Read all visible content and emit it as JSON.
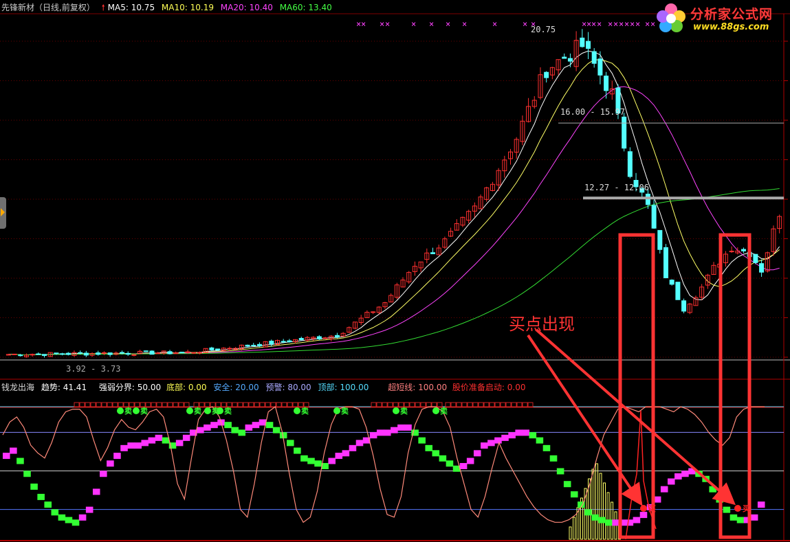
{
  "header": {
    "stock_title": "先锋新材（日线,前复权）",
    "ma_items": [
      {
        "label": "MA5:",
        "value": "10.75",
        "color": "#ffffff"
      },
      {
        "label": "MA10:",
        "value": "10.19",
        "color": "#ffff55"
      },
      {
        "label": "MA20:",
        "value": "10.40",
        "color": "#ff44ff"
      },
      {
        "label": "MA60:",
        "value": "13.40",
        "color": "#44ff44"
      }
    ],
    "logo_text": "分析家公式网",
    "logo_url": "www.88gs.com"
  },
  "main_chart": {
    "high_label": "20.75",
    "low_label": "3.92 - 3.73",
    "level1_label": "16.00 - 15.97",
    "level2_label": "12.27 - 12.06",
    "annotation": "买点出现",
    "colors": {
      "up": "#ff3030",
      "down": "#54ffff",
      "ma5": "#ffffff",
      "ma10": "#ffff66",
      "ma20": "#ff44ff",
      "ma60": "#33dd33",
      "box": "#ff3333"
    }
  },
  "indicator": {
    "name": "钱龙出海",
    "fields": [
      {
        "label": "趋势:",
        "value": "41.41",
        "color": "#ffffff"
      },
      {
        "label": "强弱分界:",
        "value": "50.00",
        "color": "#ffffff"
      },
      {
        "label": "底部:",
        "value": "0.00",
        "color": "#ffff55"
      },
      {
        "label": "安全:",
        "value": "20.00",
        "color": "#55aaff"
      },
      {
        "label": "预警:",
        "value": "80.00",
        "color": "#aaaaff"
      },
      {
        "label": "顶部:",
        "value": "100.00",
        "color": "#55ddff"
      },
      {
        "label": "超短线:",
        "value": "100.00",
        "color": "#ff8080"
      },
      {
        "label": "股价准备启动:",
        "value": "0.00",
        "color": "#ff3030"
      }
    ],
    "signal_text": "卖",
    "buy_text": "买"
  },
  "chart_data": {
    "type": "candlestick",
    "title": "先锋新材（日线,前复权）",
    "price_range": [
      3.73,
      20.75
    ],
    "ma_lines": [
      "MA5",
      "MA10",
      "MA20",
      "MA60"
    ],
    "ma_values": {
      "MA5": 10.75,
      "MA10": 10.19,
      "MA20": 10.4,
      "MA60": 13.4
    },
    "price_levels": [
      {
        "label": "16.00 - 15.97",
        "value": 15.97
      },
      {
        "label": "12.27 - 12.06",
        "value": 12.06
      }
    ],
    "indicator_levels": {
      "底部": 0,
      "安全": 20,
      "强弱分界": 50,
      "预警": 80,
      "顶部": 100
    },
    "trend_values": [
      62,
      66,
      58,
      48,
      38,
      30,
      24,
      18,
      14,
      12,
      10,
      14,
      20,
      34,
      48,
      56,
      62,
      68,
      70,
      70,
      72,
      74,
      76,
      74,
      70,
      72,
      76,
      80,
      82,
      84,
      86,
      88,
      86,
      82,
      80,
      84,
      86,
      88,
      86,
      82,
      78,
      72,
      66,
      60,
      58,
      56,
      54,
      58,
      62,
      64,
      68,
      72,
      74,
      78,
      80,
      80,
      82,
      84,
      84,
      80,
      74,
      68,
      64,
      60,
      56,
      52,
      54,
      58,
      64,
      70,
      72,
      74,
      76,
      78,
      80,
      80,
      78,
      74,
      68,
      60,
      50,
      40,
      32,
      24,
      18,
      14,
      12,
      10,
      10,
      10,
      10,
      12,
      16,
      22,
      28,
      36,
      42,
      46,
      48,
      50,
      48,
      44,
      36,
      28,
      20,
      14,
      12,
      12,
      14,
      24
    ],
    "short_term_values": [
      78,
      88,
      92,
      84,
      70,
      64,
      60,
      72,
      88,
      96,
      98,
      98,
      92,
      74,
      58,
      68,
      82,
      90,
      84,
      82,
      88,
      96,
      98,
      92,
      70,
      40,
      28,
      60,
      90,
      98,
      100,
      92,
      74,
      50,
      20,
      14,
      40,
      72,
      96,
      100,
      80,
      48,
      20,
      10,
      14,
      34,
      64,
      86,
      98,
      100,
      100,
      98,
      84,
      62,
      36,
      16,
      14,
      30,
      64,
      86,
      98,
      100,
      100,
      96,
      84,
      60,
      40,
      20,
      14,
      30,
      52,
      72,
      60,
      50,
      40,
      30,
      22,
      16,
      12,
      10,
      10,
      12,
      16,
      24,
      40,
      60,
      78,
      88,
      98,
      100,
      98,
      96,
      100,
      100,
      100,
      98,
      96,
      100,
      98,
      94,
      88,
      80,
      74,
      70,
      76,
      92,
      98,
      100,
      100,
      100
    ]
  }
}
